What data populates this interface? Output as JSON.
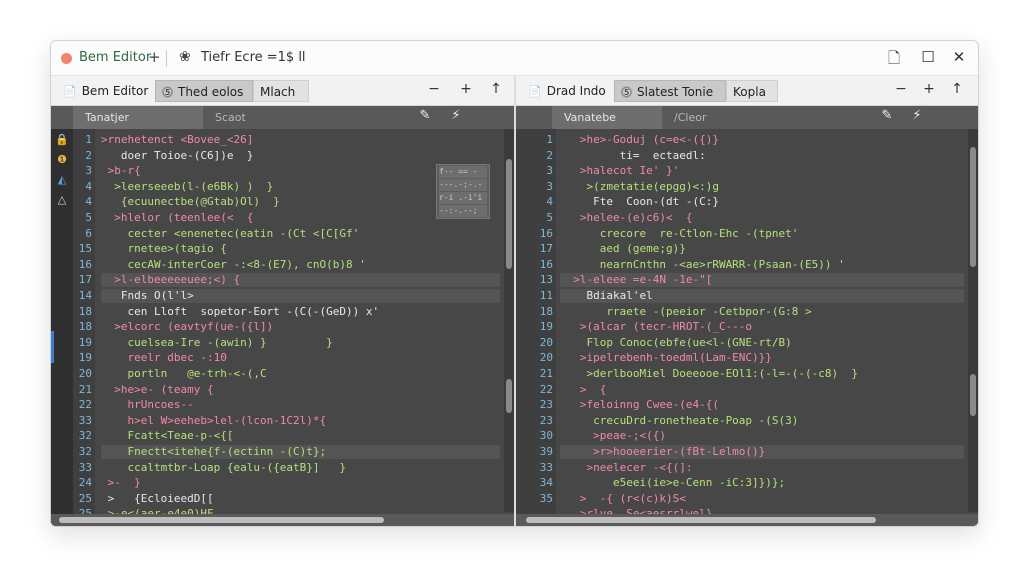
{
  "window": {
    "title_app": "Bem Editor",
    "title_plus": "+",
    "title_link_icon": "link-icon",
    "title_doc": "Tiefr Ecre =1$ ll",
    "controls": [
      "page-icon",
      "maximize-icon",
      "close-icon"
    ],
    "control_glyphs": [
      "🗋",
      "☐",
      "✕"
    ]
  },
  "left_pane": {
    "tabs": [
      {
        "icon": "📄",
        "label": "Bem Editor"
      },
      {
        "icon": "⓹",
        "label": "Thed eolos"
      },
      {
        "icon": "",
        "label": "Mlach"
      }
    ],
    "controls": [
      "−",
      "+",
      "↑"
    ],
    "subtabs": [
      "Tanatjer",
      "Scaot"
    ],
    "sub_controls": [
      "✎",
      "⚡"
    ],
    "activity_icons": [
      {
        "glyph": "🔒",
        "color": "#cfcfcf"
      },
      {
        "glyph": "❶",
        "color": "#e9b34a"
      },
      {
        "glyph": "◭",
        "color": "#5a9ee0"
      },
      {
        "glyph": "△",
        "color": "#cfcfcf"
      }
    ],
    "line_numbers": [
      "1",
      "2",
      "3",
      "4",
      "4",
      "5",
      "6",
      "15",
      "16",
      "17",
      "14",
      "18",
      "18",
      "19",
      "19",
      "20",
      "21",
      "22",
      "33",
      "32",
      "32",
      "33",
      "24",
      "25",
      "25",
      "26"
    ],
    "lines": [
      {
        "t": "k",
        "v": ">rnehetenct <Bovee_<26]"
      },
      {
        "t": "p",
        "v": "   doer Toioe-(C6])e  }"
      },
      {
        "t": "k",
        "v": " >b-r{"
      },
      {
        "t": "s",
        "v": "  >leerseeeb(l-(e6Bk) )  }"
      },
      {
        "t": "s",
        "v": "   {ecuunectbe(@Gtab)Ol)  }"
      },
      {
        "t": "k",
        "v": "  >hlelor (teenlee(<  {"
      },
      {
        "t": "s",
        "v": "    cecter <enenetec(eatin -(Ct <[C[Gf'"
      },
      {
        "t": "s",
        "v": "    rnetee>(tagio {"
      },
      {
        "t": "s",
        "v": "    cecAW-interCoer -:<8-(E7), cnO(b)8 '"
      },
      {
        "t": "k",
        "v": "  >l-elbeeeeeuee;<) {"
      },
      {
        "t": "p",
        "v": "   Fnds O(l'l>"
      },
      {
        "t": "p",
        "v": "    cen Lloft  sopetor-Eort -(C(-(GeD)) x'"
      },
      {
        "t": "k",
        "v": "  >elcorc (eavtyf(ue-({l])"
      },
      {
        "t": "s",
        "v": "    cuelsea-Ire -(awin) }         }"
      },
      {
        "t": "k",
        "v": "    reelr dbec -:10"
      },
      {
        "t": "s",
        "v": "    portln   @e-trh-<-(,C"
      },
      {
        "t": "k",
        "v": "  >he>e- (teamy {"
      },
      {
        "t": "k",
        "v": "    hrUncoes--"
      },
      {
        "t": "k",
        "v": "    h>el W>eeheb>lel-(lcon-1C2l)*{"
      },
      {
        "t": "s",
        "v": "    Fcatt<Teae-p-<{["
      },
      {
        "t": "s",
        "v": "    Fnectt<itehe{f-(ectinn -(C)t};"
      },
      {
        "t": "s",
        "v": "    ccaltmtbr-Loap {ealu-({eatB}]   }"
      },
      {
        "t": "k",
        "v": " >-  }"
      },
      {
        "t": "p",
        "v": " >   {EcloieedD[["
      },
      {
        "t": "s",
        "v": " >-e<(aer-e4e0)HF"
      },
      {
        "t": "s",
        "v": " >-eltyrue-recor}r -(lop -c2i}) x"
      }
    ],
    "minimap": [
      "f-- == -i;)",
      "---.-;-.-",
      "r-i .-i'i",
      "--:-.--;"
    ]
  },
  "right_pane": {
    "tabs": [
      {
        "icon": "📄",
        "label": "Drad Indo"
      },
      {
        "icon": "⓹",
        "label": "Slatest Tonie"
      },
      {
        "icon": "",
        "label": "Kopla"
      }
    ],
    "controls": [
      "−",
      "+",
      "↑"
    ],
    "subtabs": [
      "Vanatebe",
      "/Cleor"
    ],
    "sub_controls": [
      "✎",
      "⚡"
    ],
    "line_numbers": [
      "1",
      "2",
      "3",
      "3",
      "4",
      "5",
      "16",
      "17",
      "16",
      "13",
      "11",
      "18",
      "19",
      "20",
      "20",
      "21",
      "22",
      "23",
      "23",
      "30",
      "39",
      "33",
      "34",
      "35"
    ],
    "lines": [
      {
        "t": "k",
        "v": "   >he>-Goduj (c=e<-({)}"
      },
      {
        "t": "p",
        "v": "         ti=  ectaedl:"
      },
      {
        "t": "k",
        "v": "   >halecot Ie' }'"
      },
      {
        "t": "s",
        "v": "    >(zmetatie(epgg)<:)g"
      },
      {
        "t": "p",
        "v": "     Fte  Coon-(dt -(C:}"
      },
      {
        "t": "k",
        "v": "   >helee-(e)c6)<  {"
      },
      {
        "t": "s",
        "v": "      crecore  re-Ctlon-Ehc -(tpnet'"
      },
      {
        "t": "s",
        "v": "      aed (geme;g)}"
      },
      {
        "t": "s",
        "v": "      nearnCnthn -<ae>rRWARR-(Psaan-(E5)) '"
      },
      {
        "t": "k",
        "v": "  >l-eleee =e-4N -1e-\"["
      },
      {
        "t": "p",
        "v": "    Bdiakal'el"
      },
      {
        "t": "s",
        "v": "       rraete -(peeior -Cetbpor-(G:8 >"
      },
      {
        "t": "k",
        "v": "   >(alcar (tecr-HROT-(_C---o"
      },
      {
        "t": "s",
        "v": "    Flop Conoc(ebfe(ue<l-(GNE-rt/B)"
      },
      {
        "t": "k",
        "v": "   >ipelrebenh-toedml(Lam-ENC)}}"
      },
      {
        "t": "s",
        "v": "    >derlbooMiel Doeeooe-EOl1:(-l=-(-(-c8)  }"
      },
      {
        "t": "k",
        "v": "   >  {"
      },
      {
        "t": "k",
        "v": "   >feloinng Cwee-(e4-{("
      },
      {
        "t": "s",
        "v": "     crecuDrd-ronetheate-Poap -(S(3)"
      },
      {
        "t": "k",
        "v": "     >peae-;<({)"
      },
      {
        "t": "k",
        "v": "     >r>hooeerier-(fBt-Lelmo()}"
      },
      {
        "t": "k",
        "v": "    >neelecer -<{(]:"
      },
      {
        "t": "s",
        "v": "        e5eei(ie>e-Cenn -iC:3]})};"
      },
      {
        "t": "k",
        "v": "   >  -{ (r<(c)k)S<"
      },
      {
        "t": "k",
        "v": "   >rlve  Se<aesrrlwel}"
      },
      {
        "t": "k",
        "v": "      Wiesub -2)  )"
      }
    ]
  }
}
